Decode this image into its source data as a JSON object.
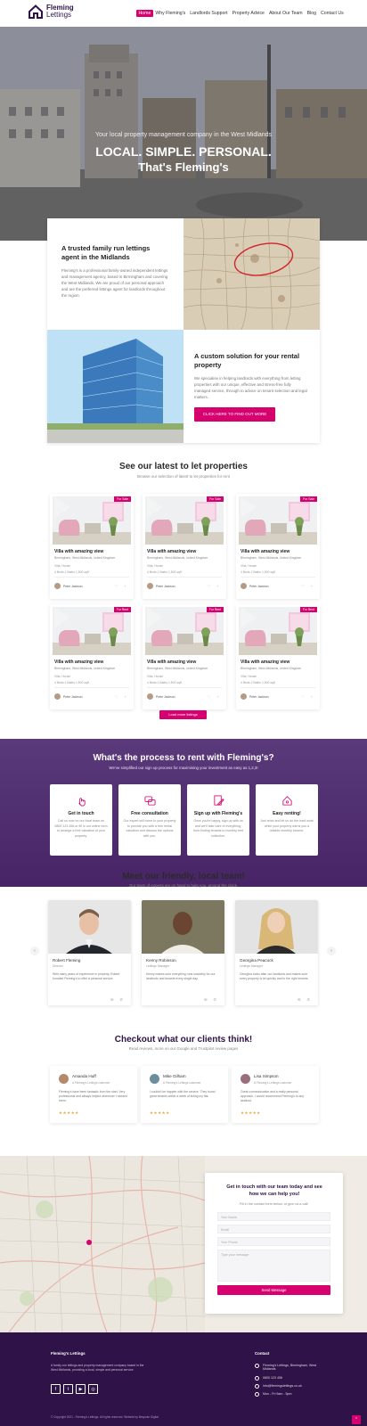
{
  "header": {
    "brand_line1": "Fleming",
    "brand_line2": "Lettings",
    "nav": [
      {
        "label": "Home",
        "active": true
      },
      {
        "label": "Why Fleming's",
        "active": false
      },
      {
        "label": "Landlords Support",
        "active": false
      },
      {
        "label": "Property Advice",
        "active": false
      },
      {
        "label": "About Our Team",
        "active": false
      },
      {
        "label": "Blog",
        "active": false
      },
      {
        "label": "Contact Us",
        "active": false
      }
    ]
  },
  "hero": {
    "tagline": "Your local property management company in the West Midlands",
    "headline1": "LOCAL. SIMPLE. PERSONAL.",
    "headline2": "That's Fleming's"
  },
  "intro": {
    "title1": "A trusted family run lettings agent in the Midlands",
    "body1": "Fleming's is a professional family-owned independent lettings and management agency, based in Birmingham and covering the West Midlands. We are proud of our personal approach and are the preferred lettings agent for landlords throughout the region.",
    "title2": "A custom solution for your rental property",
    "body2": "We specialise in helping landlords with everything from letting properties with our unique, effective and stress-free fully managed service, through to advice on tenant selection and legal matters.",
    "cta": "CLICK HERE TO FIND OUT MORE"
  },
  "properties": {
    "title": "See our latest to let properties",
    "subtitle": "Browse our selection of latest to let properties for rent",
    "items": [
      {
        "badge": "For Sale",
        "title": "Villa with amazing view",
        "address": "Birmingham, West Midlands, United Kingdom",
        "type": "Villa, House",
        "specs": "4 Beds  2 Baths  1,500 sqft",
        "agent": "Peter Jackson"
      },
      {
        "badge": "For Sale",
        "title": "Villa with amazing view",
        "address": "Birmingham, West Midlands, United Kingdom",
        "type": "Villa, House",
        "specs": "4 Beds  2 Baths  1,500 sqft",
        "agent": "Peter Jackson"
      },
      {
        "badge": "For Sale",
        "title": "Villa with amazing view",
        "address": "Birmingham, West Midlands, United Kingdom",
        "type": "Villa, House",
        "specs": "4 Beds  2 Baths  1,500 sqft",
        "agent": "Peter Jackson"
      },
      {
        "badge": "For Rent",
        "title": "Villa with amazing view",
        "address": "Birmingham, West Midlands, United Kingdom",
        "type": "Villa, House",
        "specs": "4 Beds  2 Baths  1,500 sqft",
        "agent": "Peter Jackson"
      },
      {
        "badge": "For Rent",
        "title": "Villa with amazing view",
        "address": "Birmingham, West Midlands, United Kingdom",
        "type": "Villa, House",
        "specs": "4 Beds  2 Baths  1,500 sqft",
        "agent": "Peter Jackson"
      },
      {
        "badge": "For Rent",
        "title": "Villa with amazing view",
        "address": "Birmingham, West Midlands, United Kingdom",
        "type": "Villa, House",
        "specs": "4 Beds  2 Baths  1,500 sqft",
        "agent": "Peter Jackson"
      }
    ],
    "load_more": "Load more listings"
  },
  "process": {
    "title": "What's the process to rent with Fleming's?",
    "subtitle": "We've simplified our sign up process for maximising your investment as easy as 1,2,3!",
    "steps": [
      {
        "title": "Get in touch",
        "body": "Call us now on our local team on 0800 123 456 or fill in our online form to arrange a free valuation of your property."
      },
      {
        "title": "Free consultation",
        "body": "Our expert will come to your property to provide you with a free rental valuation and discuss the options with you."
      },
      {
        "title": "Sign up with Fleming's",
        "body": "Once you're happy, sign up with us and we'll take care of everything, from finding tenants to monthly rent collection."
      },
      {
        "title": "Easy renting!",
        "body": "Just relax and let us do the hard work while your property earns you a reliable monthly income."
      }
    ]
  },
  "team": {
    "title": "Meet our friendly, local team!",
    "subtitle": "Our team of experts are on hand to help you, around the clock.",
    "members": [
      {
        "name": "Robert Fleming",
        "role": "Director",
        "bio": "With many years of experience in property, Robert founded Fleming's to offer a personal service."
      },
      {
        "name": "Kenny Robinson",
        "role": "Lettings Manager",
        "bio": "Kenny makes sure everything runs smoothly for our landlords and tenants every single day."
      },
      {
        "name": "Georgina Peacock",
        "role": "Lettings Manager",
        "bio": "Georgina looks after our landlords and makes sure every property is let quickly and to the right tenants."
      }
    ]
  },
  "testimonials": {
    "title": "Checkout what our clients think!",
    "subtitle": "Read reviews, more on our Google and Trustpilot review pages",
    "items": [
      {
        "name": "Amanda Huff",
        "sub": "A Fleming's Lettings customer",
        "text": "Fleming's have been fantastic from the start. Very professional and always helpful whenever I needed them.",
        "stars": "★★★★★"
      },
      {
        "name": "Mike Gilham",
        "sub": "A Fleming's Lettings customer",
        "text": "I couldn't be happier with the service. They found great tenants within a week of listing my flat.",
        "stars": "★★★★★"
      },
      {
        "name": "Lisa Simpson",
        "sub": "A Fleming's Lettings customer",
        "text": "Great communication and a really personal approach. I would recommend Fleming's to any landlord.",
        "stars": "★★★★★"
      }
    ]
  },
  "contact": {
    "title": "Get in touch with our team today and see how we can help you!",
    "subtitle": "Fill in the contact form below, or give us a call!",
    "name_placeholder": "Your Name",
    "email_placeholder": "Email",
    "phone_placeholder": "Your Phone",
    "message_placeholder": "Type your message",
    "send": "Send Message"
  },
  "footer": {
    "about_title": "Fleming's Lettings",
    "about_text": "A family-run lettings and property management company based in the West Midlands, providing a local, simple and personal service.",
    "contact_title": "Contact",
    "contact_rows": [
      "Fleming's Lettings, Birmingham, West Midlands",
      "0800 123 456",
      "info@flemingslettings.co.uk",
      "Mon - Fri 9am - 5pm"
    ],
    "copyright": "© Copyright 2021 - Fleming's Lettings. All rights reserved. Website by Bespoke Digital."
  },
  "colors": {
    "brand_purple": "#2f1248",
    "accent_pink": "#d6006f",
    "process_bg": "#4f2d6f"
  }
}
